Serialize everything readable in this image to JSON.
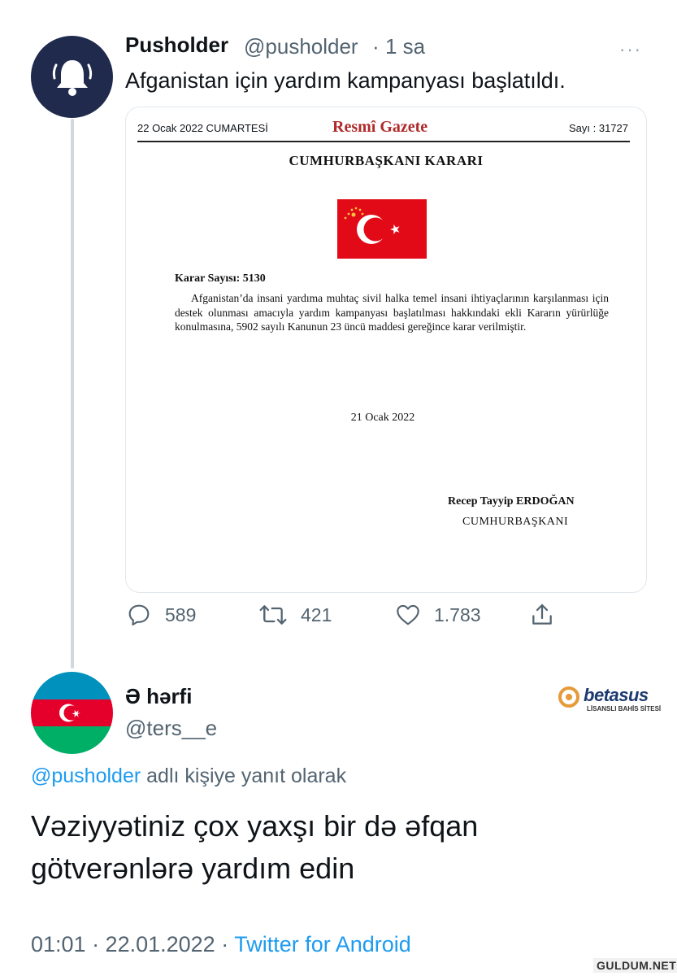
{
  "tweet": {
    "author_name": "Pusholder",
    "author_handle": "@pusholder",
    "separator": "·",
    "time_ago": "1 sa",
    "more_label": "···",
    "text": "Afganistan için yardım kampanyası başlatıldı.",
    "avatar_icon": "bell-icon",
    "media": {
      "date_line": "22 Ocak 2022 CUMARTESİ",
      "masthead": "Resmî Gazete",
      "issue": "Sayı : 31727",
      "heading": "CUMHURBAŞKANI KARARI",
      "flag_icon": "turkish-flag-icon",
      "decision_no": "Karar Sayısı: 5130",
      "body": "Afganistan’da insani yardıma muhtaç sivil halka temel insani ihtiyaçlarının karşılanması için destek olunması amacıyla yardım kampanyası başlatılması hakkındaki ekli Kararın yürürlüğe konulmasına, 5902 sayılı Kanunun 23 üncü maddesi gereğince karar verilmiştir.",
      "signed_date": "21 Ocak 2022",
      "signatory": "Recep Tayyip ERDOĞAN",
      "signatory_title": "CUMHURBAŞKANI"
    },
    "actions": {
      "replies": "589",
      "retweets": "421",
      "likes": "1.783"
    }
  },
  "reply": {
    "author_name": "Ə hərfi",
    "author_handle": "@ters__e",
    "avatar_icon": "azerbaijan-flag-icon",
    "reply_to_mention": "@pusholder",
    "reply_to_suffix": " adlı kişiye yanıt olarak",
    "text": "Vəziyyətiniz çox yaxşı bir də əfqan götverənlərə yardım edin",
    "timestamp": "01:01 · 22.01.2022 · ",
    "source": "Twitter for Android"
  },
  "overlays": {
    "brand_logo_text": "betasus",
    "brand_tagline": "LİSANSLI BAHİS SİTESİ",
    "watermark": "GULDUM.NET"
  },
  "colors": {
    "link": "#1d9bf0",
    "muted": "#536471",
    "gazette_red": "#b02a2a",
    "flag_red": "#e30a17"
  }
}
